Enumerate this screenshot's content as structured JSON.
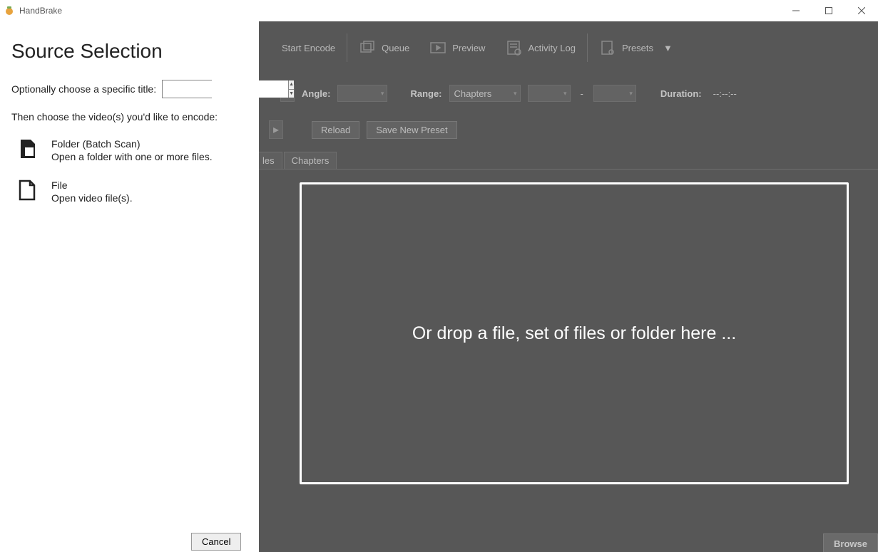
{
  "window": {
    "title": "HandBrake"
  },
  "toolbar": {
    "start_encode": "Start Encode",
    "queue": "Queue",
    "preview": "Preview",
    "activity_log": "Activity Log",
    "presets": "Presets"
  },
  "row2": {
    "angle_label": "Angle:",
    "range_label": "Range:",
    "range_value": "Chapters",
    "dash": "-",
    "duration_label": "Duration:",
    "duration_value": "--:--:--"
  },
  "row3": {
    "reload": "Reload",
    "save_preset": "Save New Preset"
  },
  "tabs": {
    "t1": "les",
    "t2": "Chapters"
  },
  "bottom": {
    "browse": "Browse"
  },
  "dropzone": {
    "text": "Or drop a file, set of files or folder here ..."
  },
  "panel": {
    "heading": "Source Selection",
    "opt_title_label": "Optionally choose a specific title:",
    "instruction": "Then choose the video(s) you'd like to encode:",
    "folder": {
      "title": "Folder (Batch Scan)",
      "sub": "Open a folder with one or more files."
    },
    "file": {
      "title": "File",
      "sub": "Open video file(s)."
    },
    "cancel": "Cancel"
  }
}
